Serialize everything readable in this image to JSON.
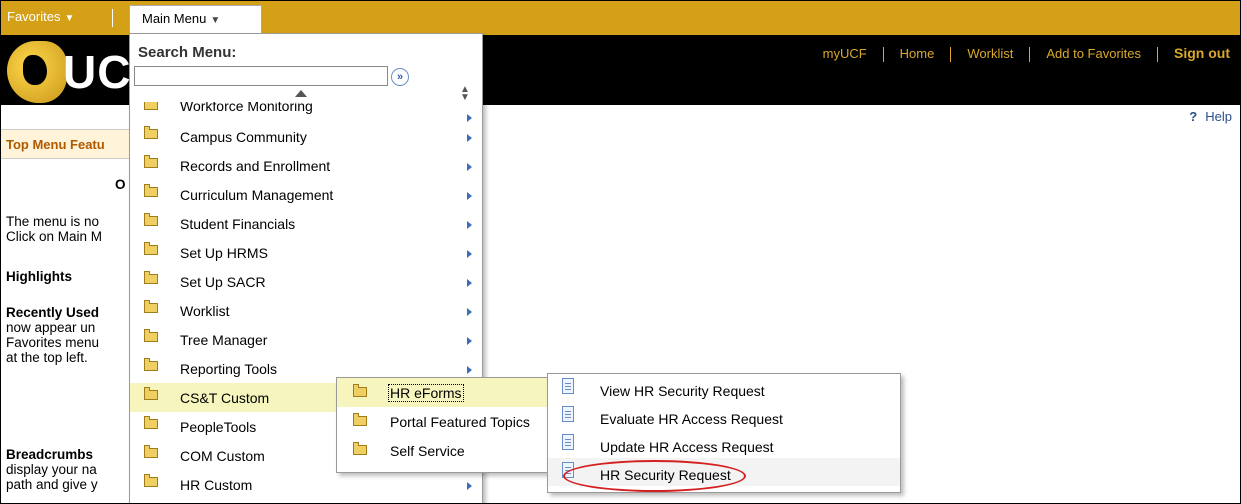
{
  "topnav": {
    "favorites_label": "Favorites",
    "main_menu_label": "Main Menu"
  },
  "banner": {
    "logo_text": "UC",
    "links": [
      "myUCF",
      "Home",
      "Worklist",
      "Add to Favorites"
    ],
    "signout": "Sign out"
  },
  "help": {
    "icon": "?",
    "label": "Help"
  },
  "left": {
    "title": "Top Menu Featu",
    "lines": [
      "O",
      "The menu is no",
      "Click on Main M",
      "Highlights",
      "Recently Used",
      "now appear un",
      "Favorites menu",
      "at the top left.",
      "Breadcrumbs",
      "display your na",
      "path and give y"
    ]
  },
  "menu": {
    "search_label": "Search Menu:",
    "search_value": "",
    "search_go": "»",
    "items": [
      {
        "label": "Workforce Monitoring"
      },
      {
        "label": "Campus Community"
      },
      {
        "label": "Records and Enrollment"
      },
      {
        "label": "Curriculum Management"
      },
      {
        "label": "Student Financials"
      },
      {
        "label": "Set Up HRMS"
      },
      {
        "label": "Set Up SACR"
      },
      {
        "label": "Worklist"
      },
      {
        "label": "Tree Manager"
      },
      {
        "label": "Reporting Tools"
      },
      {
        "label": "CS&T Custom"
      },
      {
        "label": "PeopleTools"
      },
      {
        "label": "COM Custom"
      },
      {
        "label": "HR Custom"
      }
    ]
  },
  "submenu1": {
    "items": [
      {
        "label": "HR eForms"
      },
      {
        "label": "Portal Featured Topics"
      },
      {
        "label": "Self Service"
      }
    ]
  },
  "submenu2": {
    "items": [
      {
        "label": "View HR Security Request"
      },
      {
        "label": "Evaluate HR Access Request"
      },
      {
        "label": "Update HR Access Request"
      },
      {
        "label": "HR Security Request"
      }
    ]
  },
  "colors": {
    "nav_gold": "#d4a017",
    "link_gold": "#d9a82a",
    "highlight": "#f5f5bd",
    "annotation_red": "#d42020"
  }
}
